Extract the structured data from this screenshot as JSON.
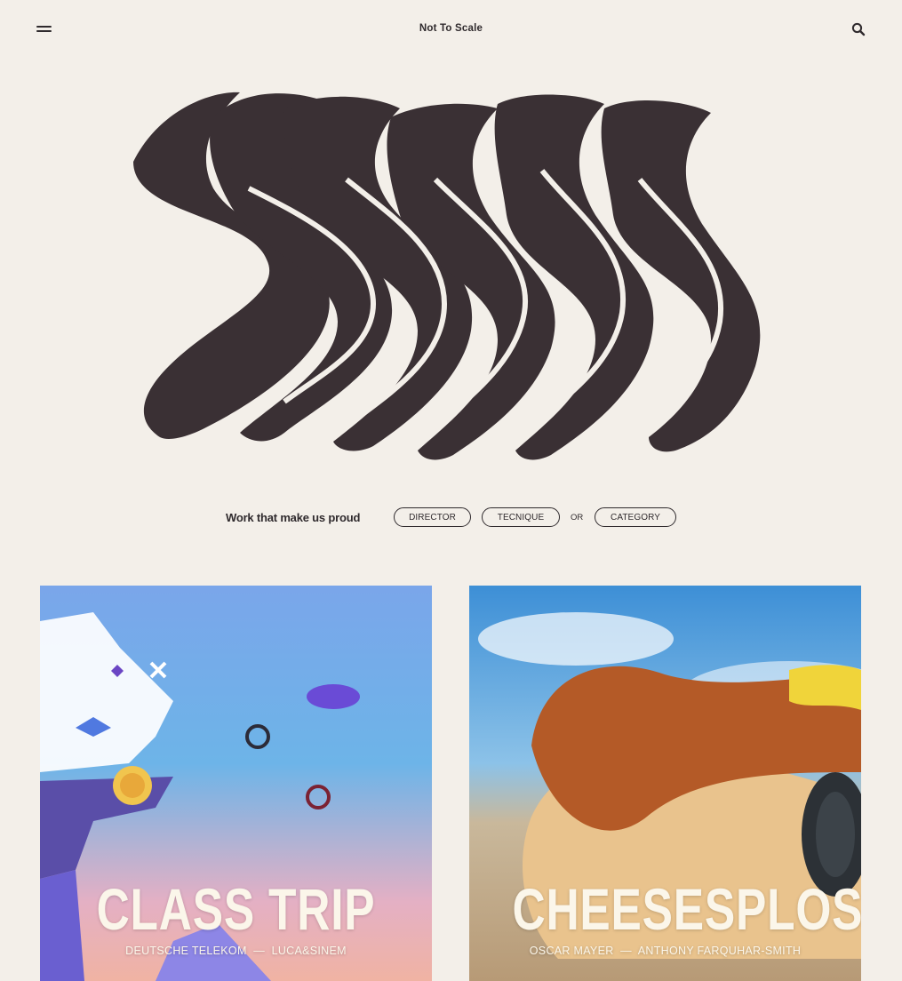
{
  "header": {
    "brand": "Not To Scale",
    "menu_icon": "hamburger-menu-icon",
    "search_icon": "search-icon"
  },
  "hero": {
    "art": "wavy-logo-graphic"
  },
  "filters": {
    "label": "Work that make us proud",
    "director": "DIRECTOR",
    "technique": "TECNIQUE",
    "or": "OR",
    "category": "CATEGORY"
  },
  "projects": [
    {
      "title": "CLASS TRIP",
      "client": "DEUTSCHE TELEKOM",
      "separator": "—",
      "director": "LUCA&SINEM"
    },
    {
      "title": "CHEESESPLOSION",
      "client": "OSCAR MAYER",
      "separator": "—",
      "director": "ANTHONY FARQUHAR-SMITH"
    }
  ],
  "colors": {
    "background": "#f3efe9",
    "ink": "#3a3034",
    "card_text": "#fbf6ea"
  }
}
